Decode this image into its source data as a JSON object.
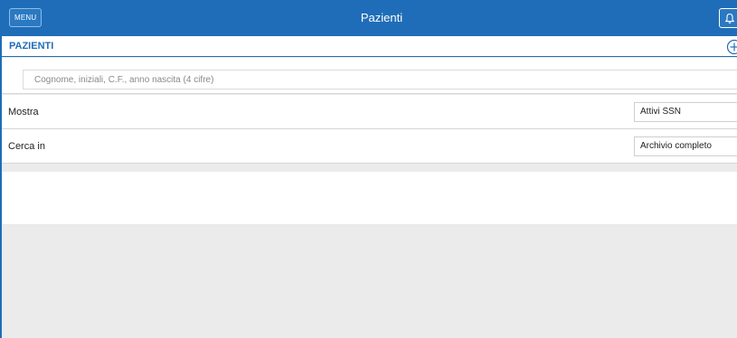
{
  "colors": {
    "accent": "#1f6db8",
    "background": "#ebebeb",
    "surface": "#ffffff",
    "divider": "#d6d6d6"
  },
  "topbar": {
    "menu_label": "MENU",
    "title": "Pazienti",
    "notification_icon": "bell-icon"
  },
  "section": {
    "title": "PAZIENTI",
    "add_icon": "plus-circle-icon"
  },
  "search": {
    "placeholder": "Cognome, iniziali, C.F., anno nascita (4 cifre)",
    "value": ""
  },
  "filters": {
    "mostra": {
      "label": "Mostra",
      "selected": "Attivi SSN"
    },
    "cerca_in": {
      "label": "Cerca in",
      "selected": "Archivio completo"
    }
  }
}
